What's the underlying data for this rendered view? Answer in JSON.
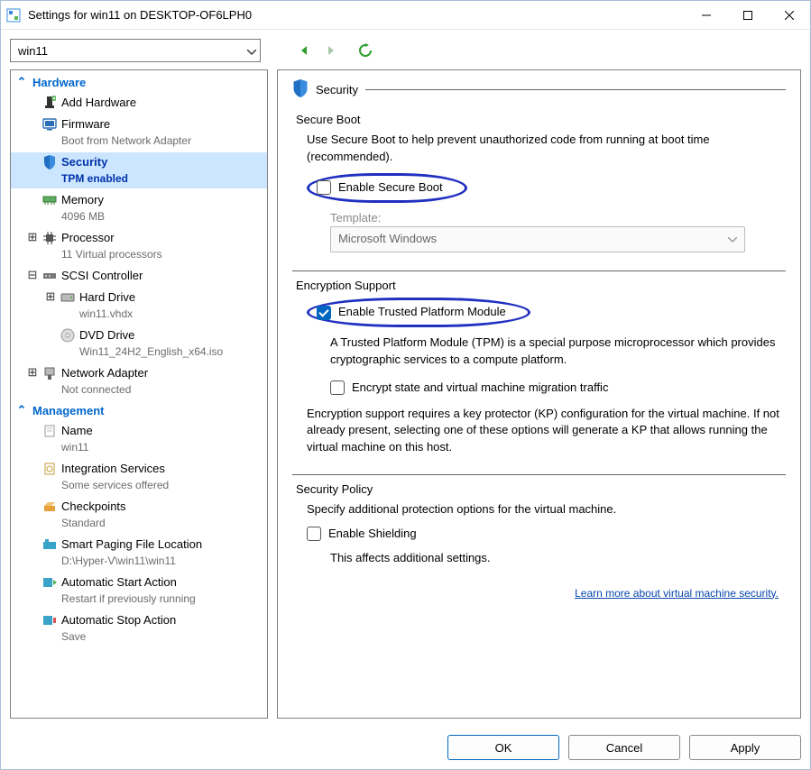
{
  "window": {
    "title": "Settings for win11 on DESKTOP-OF6LPH0"
  },
  "vm_selector": {
    "value": "win11"
  },
  "sidebar": {
    "hardware_header": "Hardware",
    "management_header": "Management",
    "items": {
      "add_hardware": {
        "label": "Add Hardware"
      },
      "firmware": {
        "label": "Firmware",
        "sub": "Boot from Network Adapter"
      },
      "security": {
        "label": "Security",
        "sub": "TPM enabled"
      },
      "memory": {
        "label": "Memory",
        "sub": "4096 MB"
      },
      "processor": {
        "label": "Processor",
        "sub": "11 Virtual processors"
      },
      "scsi": {
        "label": "SCSI Controller"
      },
      "hard_drive": {
        "label": "Hard Drive",
        "sub": "win11.vhdx"
      },
      "dvd_drive": {
        "label": "DVD Drive",
        "sub": "Win11_24H2_English_x64.iso"
      },
      "net_adapter": {
        "label": "Network Adapter",
        "sub": "Not connected"
      },
      "name": {
        "label": "Name",
        "sub": "win11"
      },
      "integration": {
        "label": "Integration Services",
        "sub": "Some services offered"
      },
      "checkpoints": {
        "label": "Checkpoints",
        "sub": "Standard"
      },
      "paging": {
        "label": "Smart Paging File Location",
        "sub": "D:\\Hyper-V\\win11\\win11"
      },
      "auto_start": {
        "label": "Automatic Start Action",
        "sub": "Restart if previously running"
      },
      "auto_stop": {
        "label": "Automatic Stop Action",
        "sub": "Save"
      }
    }
  },
  "main": {
    "title": "Security",
    "secure_boot": {
      "heading": "Secure Boot",
      "desc": "Use Secure Boot to help prevent unauthorized code from running at boot time (recommended).",
      "checkbox_label": "Enable Secure Boot",
      "template_label": "Template:",
      "template_value": "Microsoft Windows"
    },
    "encryption": {
      "heading": "Encryption Support",
      "tpm_label": "Enable Trusted Platform Module",
      "tpm_desc": "A Trusted Platform Module (TPM) is a special purpose microprocessor which provides cryptographic services to a compute platform.",
      "encrypt_label": "Encrypt state and virtual machine migration traffic",
      "kp_desc": "Encryption support requires a key protector (KP) configuration for the virtual machine. If not already present, selecting one of these options will generate a KP that allows running the virtual machine on this host."
    },
    "policy": {
      "heading": "Security Policy",
      "desc": "Specify additional protection options for the virtual machine.",
      "shielding_label": "Enable Shielding",
      "shielding_note": "This affects additional settings."
    },
    "link": "Learn more about virtual machine security."
  },
  "footer": {
    "ok": "OK",
    "cancel": "Cancel",
    "apply": "Apply"
  }
}
